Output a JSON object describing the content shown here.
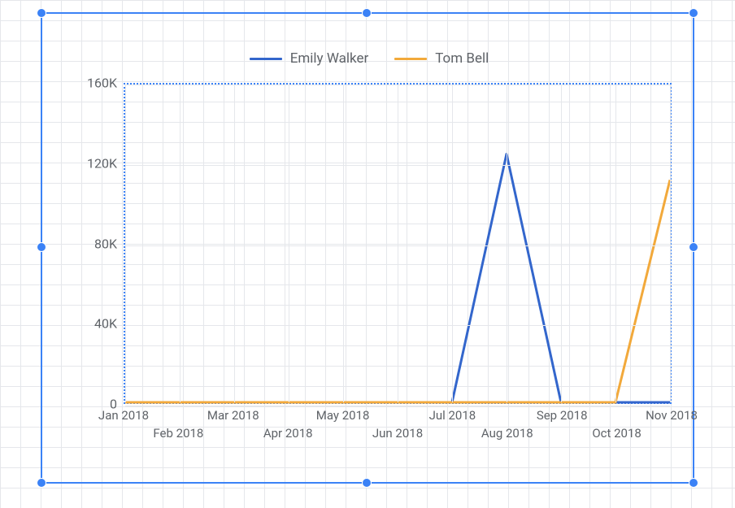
{
  "selection": {
    "handles": [
      "tl",
      "tm",
      "tr",
      "ml",
      "mr",
      "bl",
      "bm",
      "br"
    ]
  },
  "chart_data": {
    "type": "line",
    "categories": [
      "Jan 2018",
      "Feb 2018",
      "Mar 2018",
      "Apr 2018",
      "May 2018",
      "Jun 2018",
      "Jul 2018",
      "Aug 2018",
      "Sep 2018",
      "Oct 2018",
      "Nov 2018"
    ],
    "series": [
      {
        "name": "Emily Walker",
        "color": "#3366cc",
        "values": [
          0,
          0,
          0,
          0,
          0,
          0,
          0,
          125000,
          0,
          0,
          0
        ]
      },
      {
        "name": "Tom Bell",
        "color": "#f2a93b",
        "values": [
          0,
          0,
          0,
          0,
          0,
          0,
          0,
          0,
          0,
          0,
          112000
        ]
      }
    ],
    "ylabel": "",
    "xlabel": "",
    "ylim": [
      0,
      160000
    ],
    "y_ticks": [
      {
        "v": 0,
        "label": "0"
      },
      {
        "v": 40000,
        "label": "40K"
      },
      {
        "v": 80000,
        "label": "80K"
      },
      {
        "v": 120000,
        "label": "120K"
      },
      {
        "v": 160000,
        "label": "160K"
      }
    ],
    "legend_position": "top"
  }
}
